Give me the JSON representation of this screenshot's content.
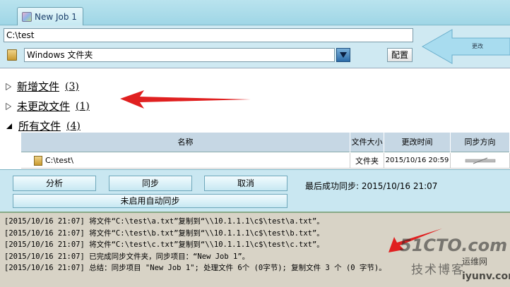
{
  "tab": {
    "title": "New Job 1"
  },
  "form": {
    "path_value": "C:\\test",
    "folder_type": "Windows 文件夹",
    "config_label": "配置"
  },
  "annotation": {
    "cyan_label": "更改"
  },
  "groups": [
    {
      "label": "新增文件",
      "count": "(3)",
      "expanded": false
    },
    {
      "label": "未更改文件",
      "count": "(1)",
      "expanded": false
    },
    {
      "label": "所有文件",
      "count": "(4)",
      "expanded": true
    }
  ],
  "table": {
    "headers": {
      "name": "名称",
      "size": "文件大小",
      "modified": "更改时间",
      "direction": "同步方向"
    },
    "rows": [
      {
        "name": "C:\\test\\",
        "size": "文件夹",
        "modified": "2015/10/16 20:59"
      }
    ]
  },
  "actions": {
    "analyze": "分析",
    "sync": "同步",
    "cancel": "取消",
    "auto_sync": "未启用自动同步",
    "last_sync": "最后成功同步: 2015/10/16 21:07"
  },
  "log": [
    "[2015/10/16 21:07] 将文件“C:\\test\\a.txt”复制到“\\\\10.1.1.1\\c$\\test\\a.txt”。",
    "[2015/10/16 21:07] 将文件“C:\\test\\b.txt”复制到“\\\\10.1.1.1\\c$\\test\\b.txt”。",
    "[2015/10/16 21:07] 将文件“C:\\test\\c.txt”复制到“\\\\10.1.1.1\\c$\\test\\c.txt”。",
    "[2015/10/16 21:07] 已完成同步文件夹，同步项目：“New Job 1”。",
    "[2015/10/16 21:07] 总结：同步项目 \"New Job 1\"; 处理文件 6个 (0字节); 复制文件 3 个 (0 字节)。"
  ],
  "watermark": {
    "top": "51CTO.com",
    "mid": "技术博客",
    "site": "运维网",
    "url": "iyunv.com"
  },
  "colors": {
    "accent_red": "#e02020",
    "cyan_arrow": "#a8dcef"
  }
}
